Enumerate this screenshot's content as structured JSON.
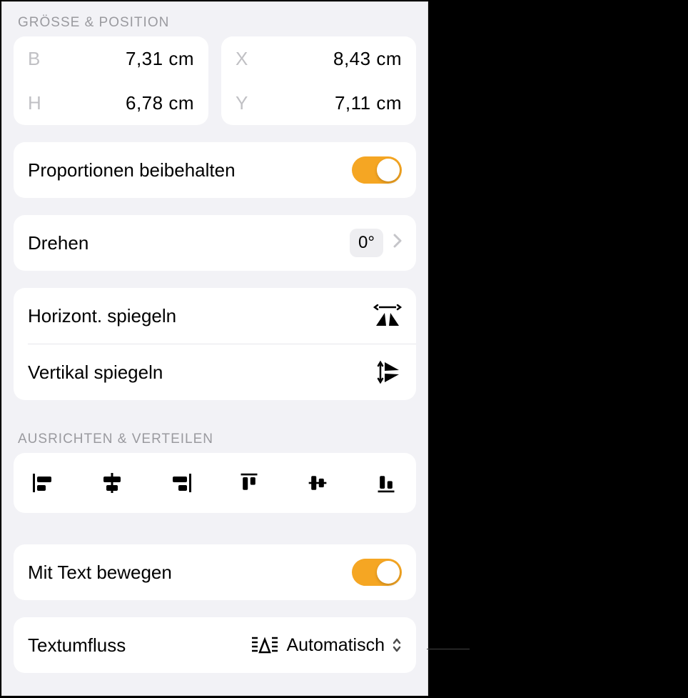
{
  "sizepos": {
    "label": "Größe & Position",
    "w_key": "B",
    "w_val": "7,31 cm",
    "h_key": "H",
    "h_val": "6,78 cm",
    "x_key": "X",
    "x_val": "8,43 cm",
    "y_key": "Y",
    "y_val": "7,11 cm"
  },
  "constrain": {
    "label": "Proportionen beibehalten"
  },
  "rotate": {
    "label": "Drehen",
    "value": "0°"
  },
  "flip_h": {
    "label": "Horizont. spiegeln"
  },
  "flip_v": {
    "label": "Vertikal spiegeln"
  },
  "align": {
    "label": "Ausrichten & Verteilen"
  },
  "movewtext": {
    "label": "Mit Text bewegen"
  },
  "wrap": {
    "label": "Textumfluss",
    "value": "Automatisch"
  }
}
